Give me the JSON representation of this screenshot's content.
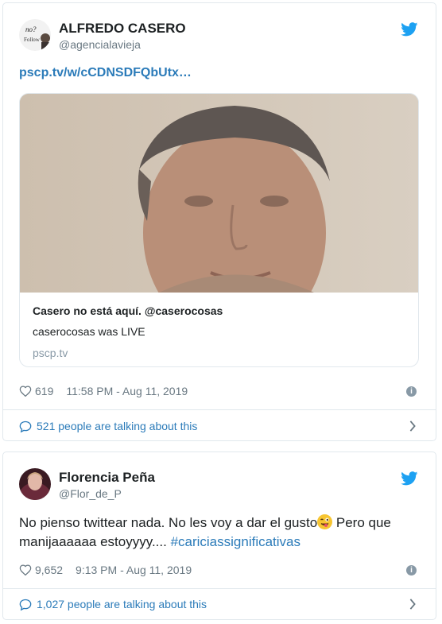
{
  "colors": {
    "link": "#2b7bb9",
    "muted": "#697882",
    "twitter_blue": "#1da1f2",
    "border": "#e1e8ed"
  },
  "tweet1": {
    "name": "ALFREDO CASERO",
    "handle": "@agencialavieja",
    "link_text": "pscp.tv/w/cCDNSDFQbUtx…",
    "card": {
      "title": "Casero no está aquí. @caserocosas",
      "description": "caserocosas was LIVE",
      "domain": "pscp.tv"
    },
    "likes": "619",
    "timestamp": "11:58 PM - Aug 11, 2019",
    "talking": "521 people are talking about this"
  },
  "tweet2": {
    "name": "Florencia Peña",
    "handle": "@Flor_de_P",
    "text_part1": "No pienso twittear nada. No les voy a dar el gusto",
    "text_part2": " Pero que manijaaaaaa estoyyyy.... ",
    "hashtag": "#cariciassignificativas",
    "likes": "9,652",
    "timestamp": "9:13 PM - Aug 11, 2019",
    "talking": "1,027 people are talking about this"
  }
}
